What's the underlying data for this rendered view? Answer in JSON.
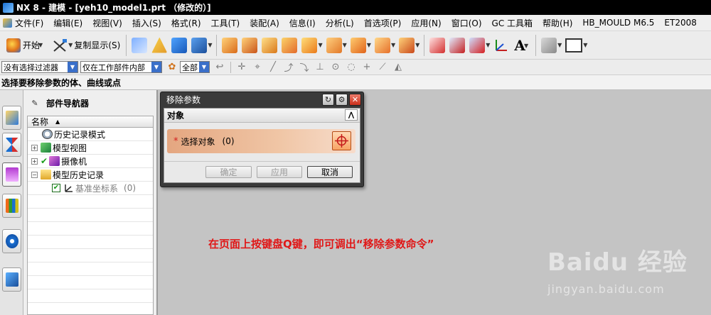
{
  "window": {
    "title": "NX 8 - 建模 - [yeh10_model1.prt （修改的）]"
  },
  "menubar": {
    "items": [
      "文件(F)",
      "编辑(E)",
      "视图(V)",
      "插入(S)",
      "格式(R)",
      "工具(T)",
      "装配(A)",
      "信息(I)",
      "分析(L)",
      "首选项(P)",
      "应用(N)",
      "窗口(O)",
      "GC 工具箱",
      "帮助(H)",
      "HB_MOULD M6.5",
      "ET2008"
    ]
  },
  "toolbar": {
    "start_label": "开始",
    "copy_display_label": "复制显示(S)",
    "text_tool_label": "A"
  },
  "filterbar": {
    "type_filter": "没有选择过滤器",
    "scope_filter": "仅在工作部件内部",
    "snap_filter": "全部"
  },
  "cue_line": "选择要移除参数的体、曲线或点",
  "resource_bar": {
    "tabs": [
      "assembly-navigator-icon",
      "constraint-navigator-icon",
      "part-navigator-icon",
      "reuse-library-icon",
      "web-browser-icon",
      "history-icon"
    ]
  },
  "part_navigator": {
    "title": "部件导航器",
    "column_name": "名称",
    "rows": [
      {
        "label": "历史记录模式",
        "icon": "clock-icon",
        "expander": ""
      },
      {
        "label": "模型视图",
        "icon": "model-views-icon",
        "expander": "+"
      },
      {
        "label": "摄像机",
        "icon": "camera-icon",
        "expander": "+"
      },
      {
        "label": "模型历史记录",
        "icon": "folder-icon",
        "expander": "−"
      },
      {
        "label": "基准坐标系",
        "icon": "datum-csys-icon",
        "suffix": "(0)"
      }
    ]
  },
  "dialog": {
    "title": "移除参数",
    "group_title": "对象",
    "select_label": "选择对象",
    "select_count": "(0)",
    "ok_label": "确定",
    "apply_label": "应用",
    "cancel_label": "取消"
  },
  "annotation": {
    "text": "在页面上按键盘Q键，即可调出“移除参数命令”"
  },
  "watermark": {
    "logo": "Baidu 经验",
    "url": "jingyan.baidu.com"
  },
  "colors": {
    "annotation": "#e01818",
    "graphics_background": "#c4c4c4",
    "dialog_frame": "#3a3a3a",
    "selection_highlight": "#e4a680"
  }
}
